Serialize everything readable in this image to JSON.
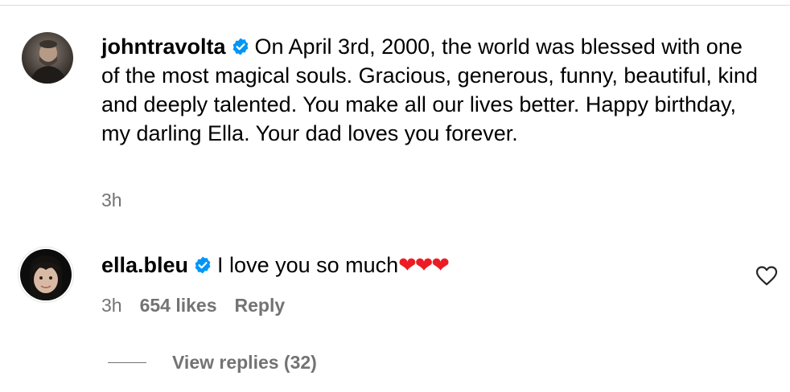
{
  "comments": [
    {
      "username": "johntravolta",
      "verified": true,
      "text": "On April 3rd, 2000, the world was blessed with one of the most magical souls. Gracious, generous, funny, beautiful, kind and deeply talented. You make all our lives better. Happy birthday, my darling Ella. Your dad loves you forever.",
      "time": "3h"
    },
    {
      "username": "ella.bleu",
      "verified": true,
      "text": "I love you so much",
      "hearts": "❤❤❤",
      "time": "3h",
      "likes": "654 likes",
      "reply_label": "Reply",
      "view_replies_label": "View replies (32)"
    }
  ],
  "colors": {
    "verified_badge": "#0095f6",
    "meta_text": "#737373",
    "heart": "#ed1c24"
  },
  "icons": {
    "verified": "verified-badge-icon",
    "like": "heart-outline-icon"
  }
}
